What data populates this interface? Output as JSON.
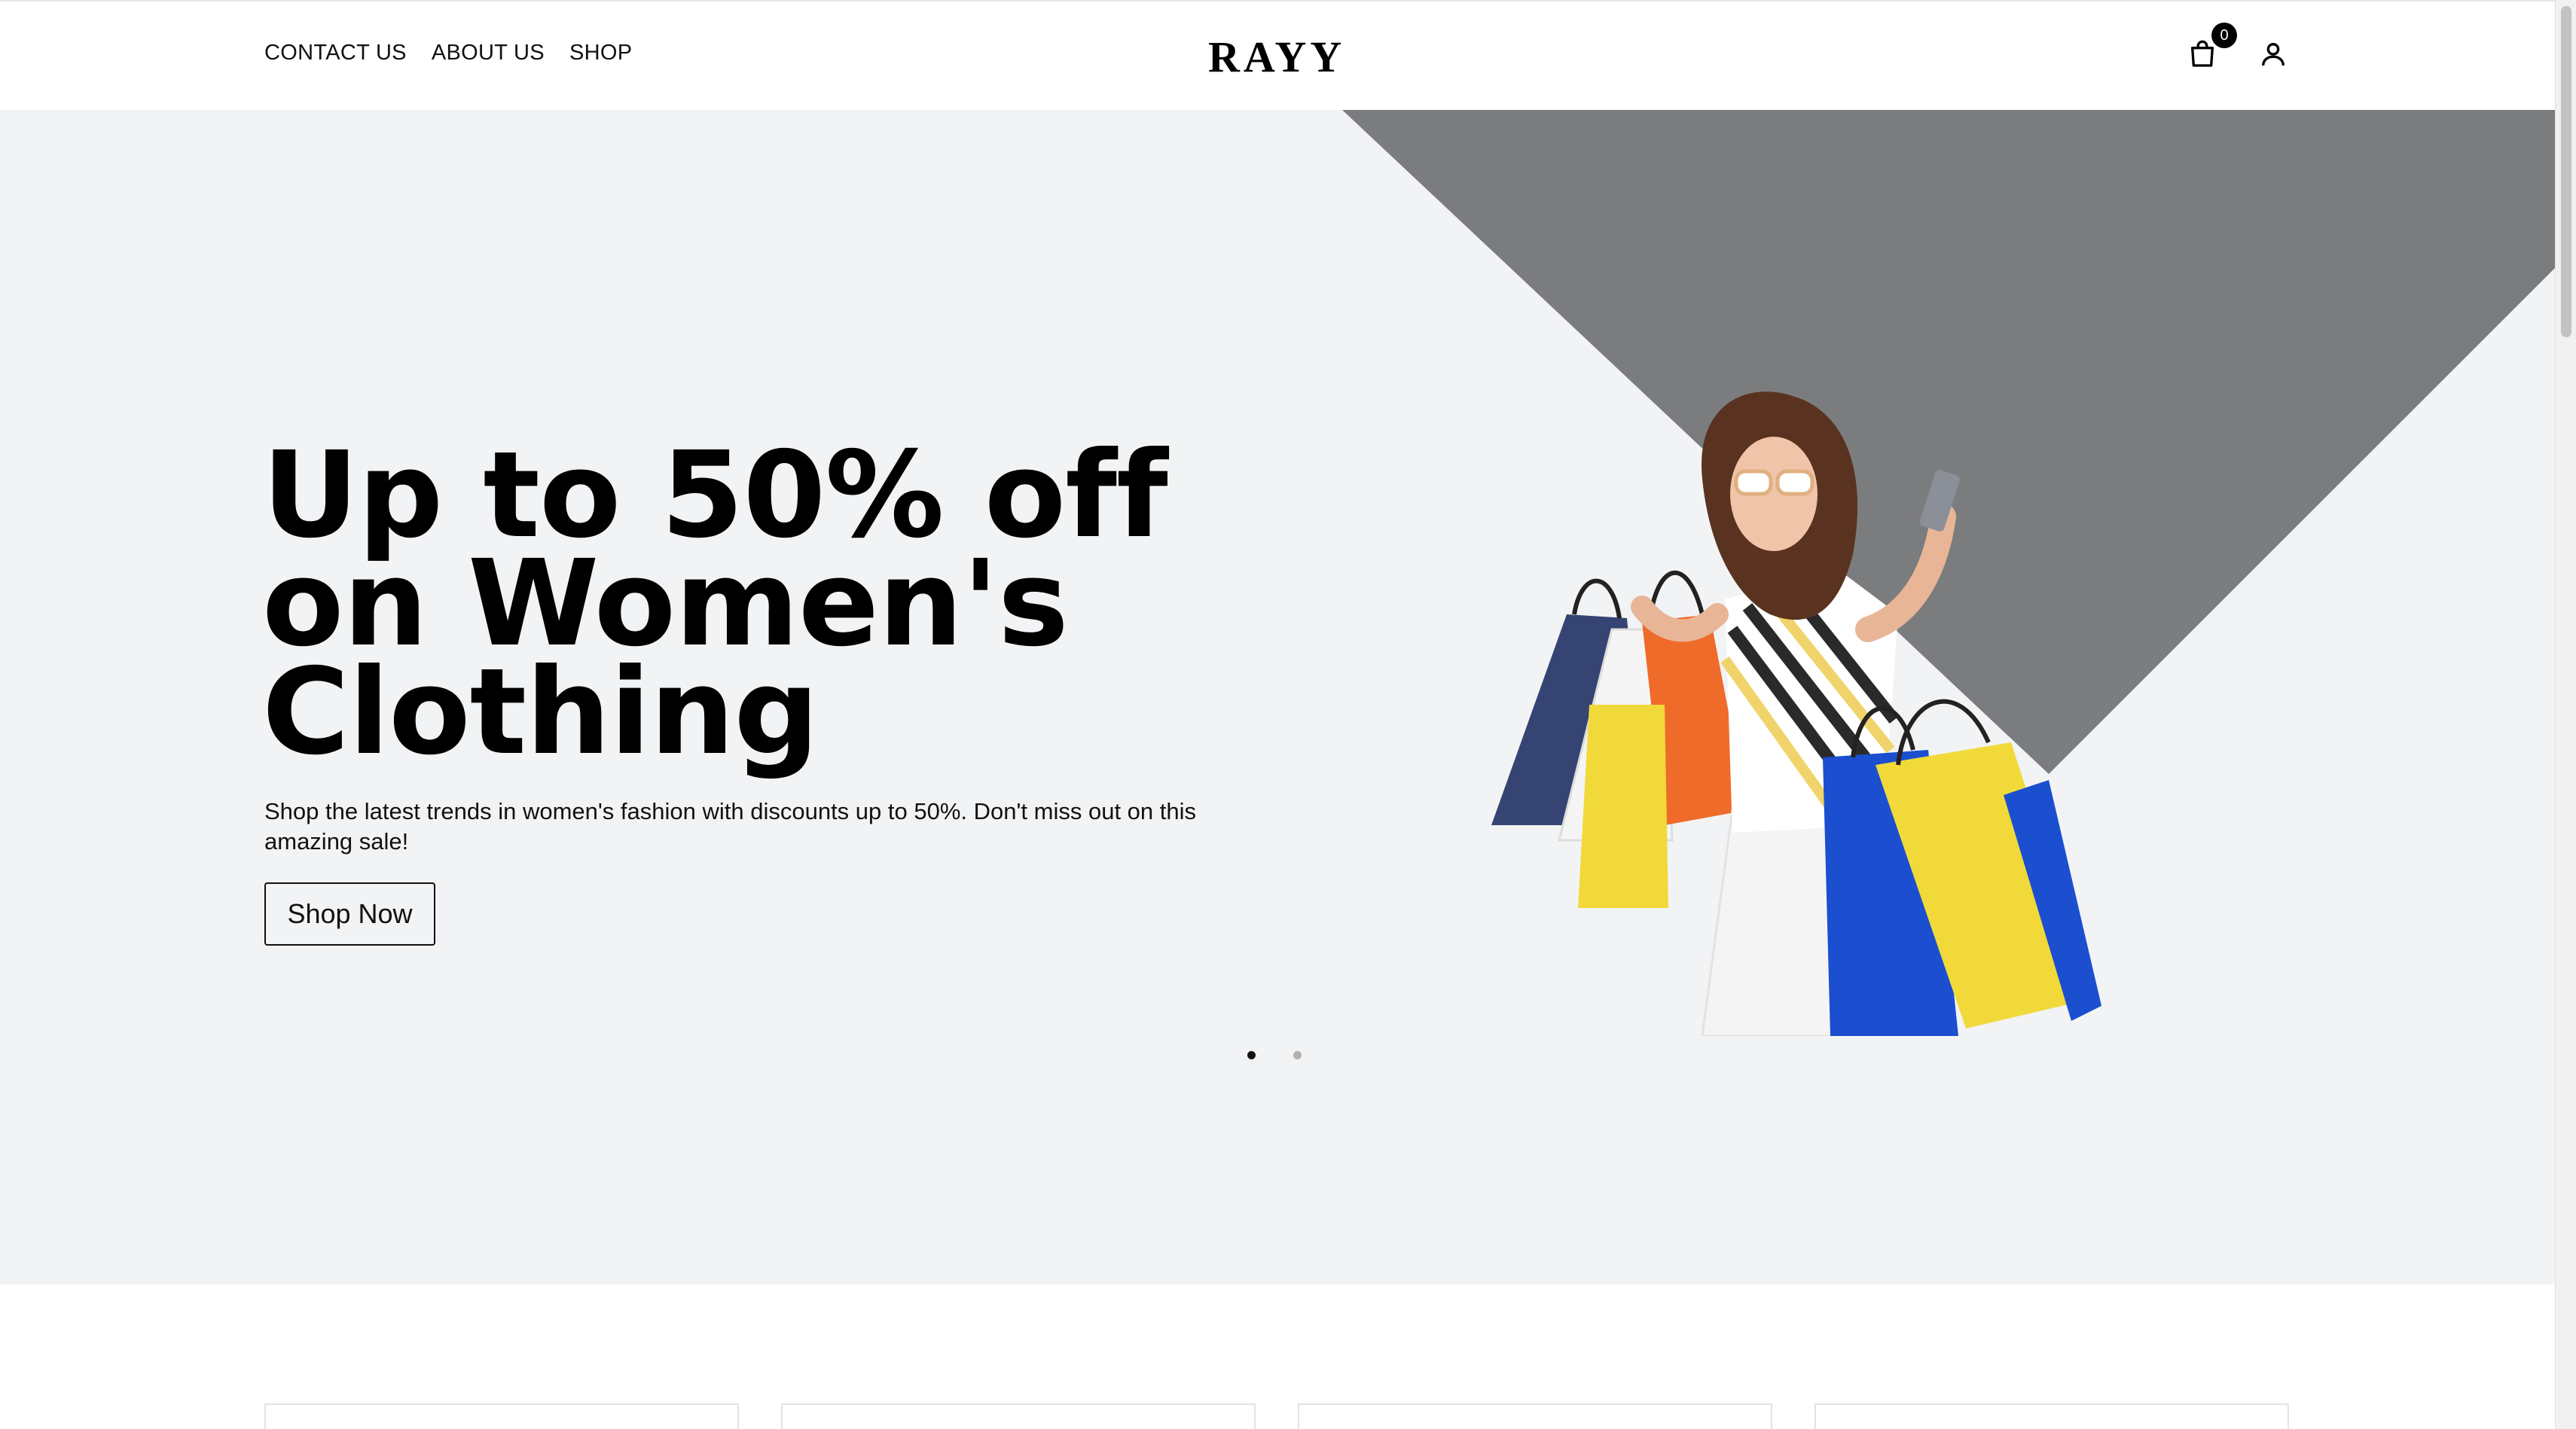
{
  "header": {
    "nav": [
      {
        "label": "CONTACT US"
      },
      {
        "label": "ABOUT US"
      },
      {
        "label": "SHOP"
      }
    ],
    "logo": "RAYY",
    "cart_count": "0",
    "cart_icon": "shopping-bag-icon",
    "account_icon": "user-icon"
  },
  "hero": {
    "title": "Up to 50% off on Women's Clothing",
    "description": "Shop the latest trends in women's fashion with discounts up to 50%. Don't miss out on this amazing sale!",
    "cta_label": "Shop Now",
    "slide_count": 2,
    "active_slide": 1
  },
  "colors": {
    "hero_bg": "#f2f3f5",
    "shape": "#7b7c7e",
    "bag_blue": "#1b4fd0",
    "bag_yellow": "#f1d93a",
    "bag_orange": "#ee6b2a",
    "bag_navy": "#2a3a6a"
  }
}
